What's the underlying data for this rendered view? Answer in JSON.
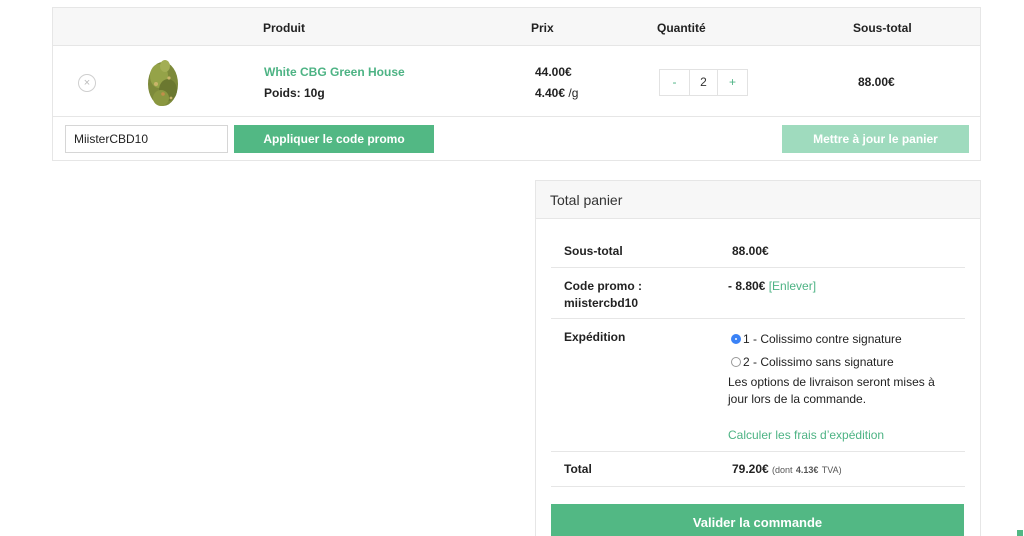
{
  "cart": {
    "headers": {
      "product": "Produit",
      "price": "Prix",
      "quantity": "Quantité",
      "subtotal": "Sous-total"
    },
    "item": {
      "remove": "×",
      "name": "White CBG Green House",
      "weight": "Poids: 10g",
      "price": "44.00€",
      "unit_price": "4.40€",
      "unit_suffix": " /g",
      "qty_minus": "-",
      "qty": "2",
      "qty_plus": "+",
      "subtotal": "88.00€"
    },
    "coupon_value": "MiisterCBD10",
    "apply_label": "Appliquer le code promo",
    "update_label": "Mettre à jour le panier"
  },
  "totals": {
    "title": "Total panier",
    "subtotal_label": "Sous-total",
    "subtotal_value": "88.00€",
    "promo_label_1": "Code promo :",
    "promo_label_2": "miistercbd10",
    "promo_value": "- 8.80€",
    "promo_remove": "[Enlever]",
    "shipping_label": "Expédition",
    "shipping_options": [
      "1 - Colissimo contre signature",
      "2 - Colissimo sans signature"
    ],
    "shipping_note_1": "Les options de livraison seront mises à",
    "shipping_note_2": "jour lors de la commande.",
    "shipping_calc": "Calculer les frais d’expédition",
    "total_label": "Total",
    "total_value": "79.20€",
    "tax_prefix": "(dont",
    "tax_amount": "4.13€",
    "tax_suffix": "TVA)",
    "checkout_label": "Valider la commande"
  },
  "colors": {
    "accent": "#52b884",
    "accent_light": "#9fdbbe",
    "link": "#4db384",
    "radio_checked": "#3b82f6"
  },
  "icons": {
    "remove": "close-icon",
    "product_image": "cannabis-flower-image"
  }
}
